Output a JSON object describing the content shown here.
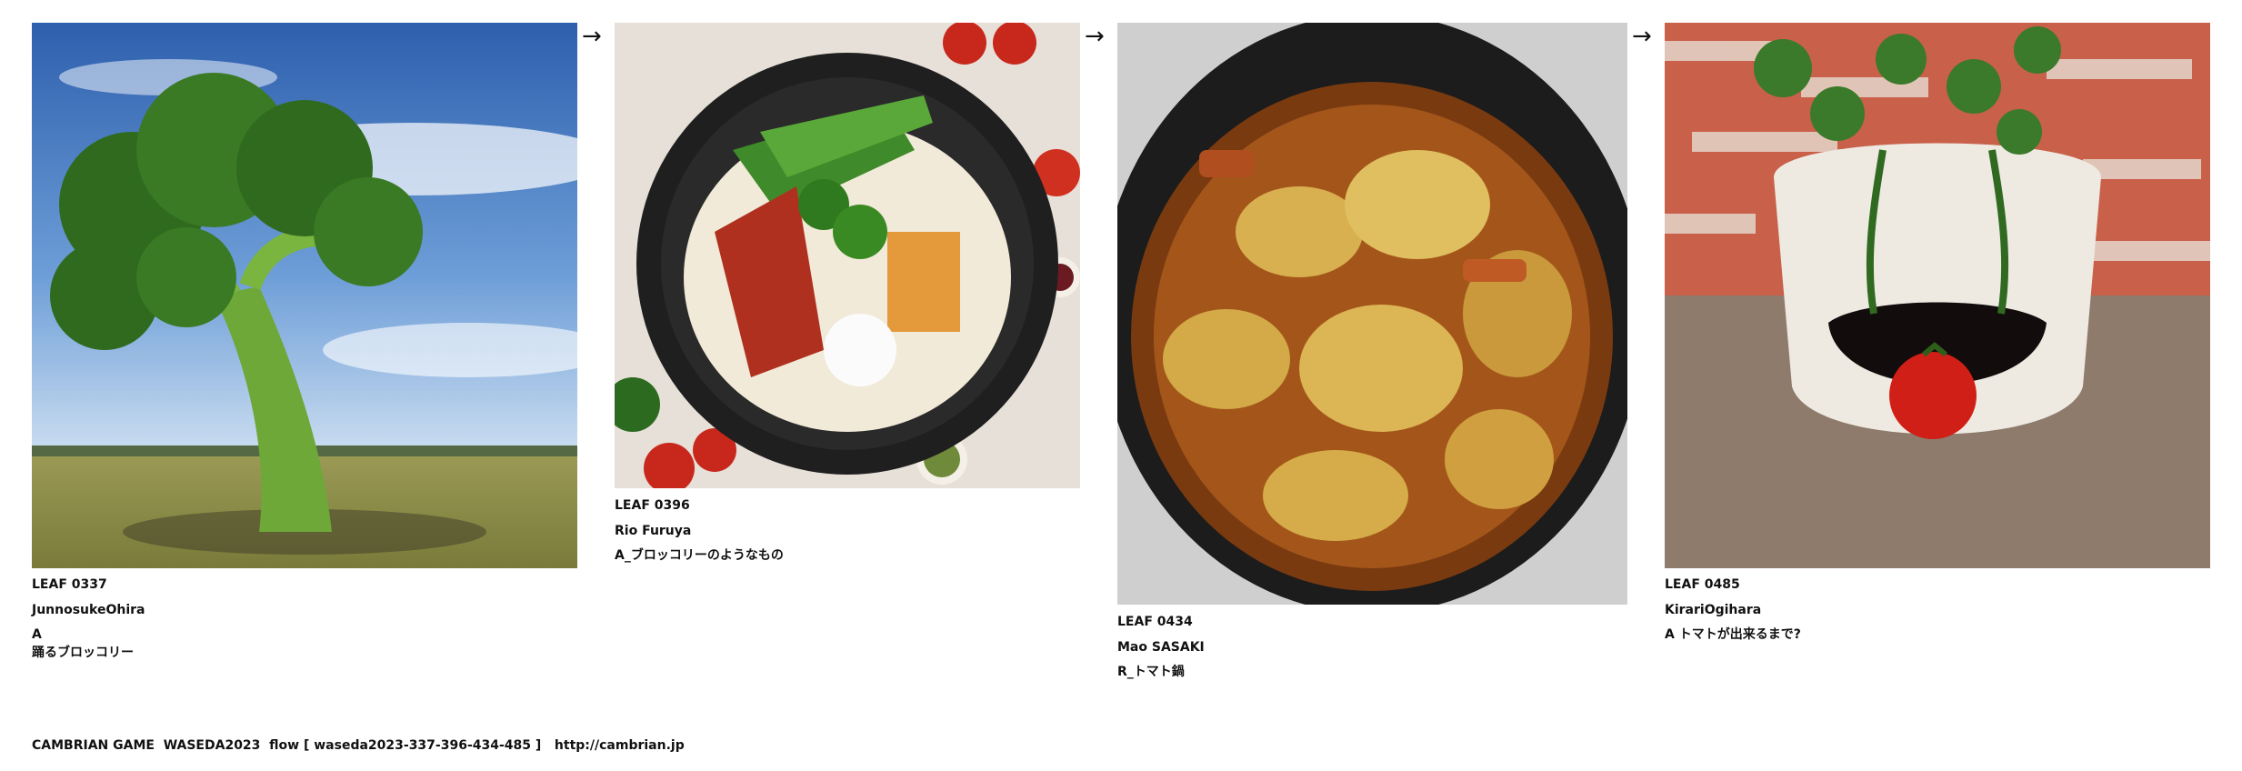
{
  "flow": {
    "arrow_glyph": "→",
    "leaves": [
      {
        "id": "LEAF 0337",
        "author": "JunnosukeOhira",
        "prompt_lines": [
          "A",
          "踊るブロッコリー"
        ],
        "image": "broccoli-tree-image"
      },
      {
        "id": "LEAF 0396",
        "author": "Rio Furuya",
        "prompt_lines": [
          "A_ブロッコリーのようなもの"
        ],
        "image": "noodle-vegetable-platter-image"
      },
      {
        "id": "LEAF 0434",
        "author": "Mao SASAKI",
        "prompt_lines": [
          "R_トマト鍋"
        ],
        "image": "cabbage-stew-pot-image"
      },
      {
        "id": "LEAF 0485",
        "author": "KirariOgihara",
        "prompt_lines": [
          "A トマトが出来るまで?"
        ],
        "image": "face-planter-tomato-image"
      }
    ]
  },
  "footer": {
    "text": "CAMBRIAN GAME  WASEDA2023  flow [ waseda2023-337-396-434-485 ]   ",
    "link": "http://cambrian.jp"
  },
  "colors": {
    "text": "#111111",
    "background": "#ffffff"
  }
}
